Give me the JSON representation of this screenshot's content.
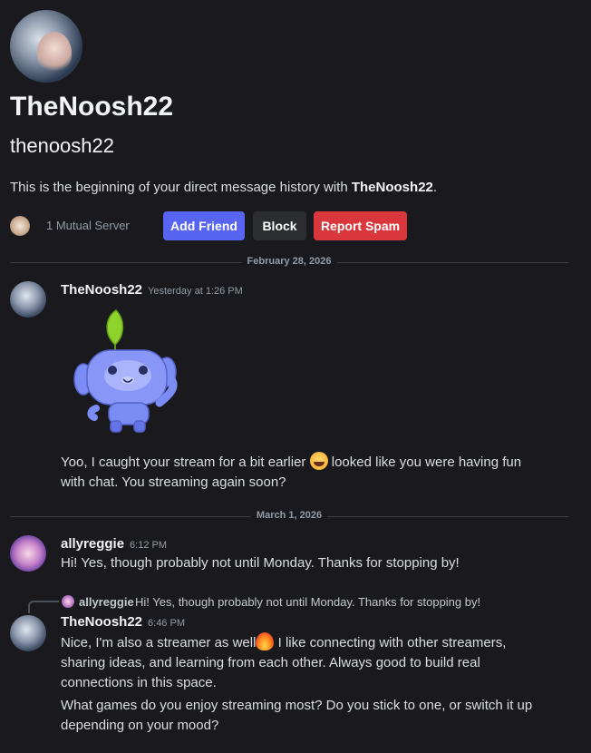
{
  "profile": {
    "display_name": "TheNoosh22",
    "username": "thenoosh22",
    "intro_prefix": "This is the beginning of your direct message history with ",
    "intro_name": "TheNoosh22",
    "intro_suffix": ".",
    "mutual_servers": "1 Mutual Server"
  },
  "actions": {
    "add_friend": "Add Friend",
    "block": "Block",
    "report_spam": "Report Spam"
  },
  "dividers": [
    "February 28, 2026",
    "March 1, 2026"
  ],
  "messages": [
    {
      "author": "TheNoosh22",
      "timestamp": "Yesterday at 1:26 PM",
      "text_before_emoji": "Yoo, I caught your stream for a bit earlier ",
      "text_after_emoji": " looked like you were having fun",
      "text_line2": "with chat. You streaming again soon?",
      "emoji": "joy-emoji"
    },
    {
      "author": "allyreggie",
      "timestamp": "6:12 PM",
      "text": "Hi! Yes, though probably not until Monday. Thanks for stopping by!"
    },
    {
      "reply_author": "allyreggie",
      "reply_text": "Hi! Yes, though probably not until Monday. Thanks for stopping by!",
      "author": "TheNoosh22",
      "timestamp": "6:46 PM",
      "text_line1_before": "Nice, I'm also a streamer as well",
      "text_line1_after": " I like connecting with other streamers,",
      "text_line2": "sharing ideas, and learning from each other. Always good to build real",
      "text_line3": "connections in this space.",
      "text_line4": "What games do you enjoy streaming most? Do you stick to one, or switch it up",
      "text_line5": "depending on your mood?",
      "emoji": "fire-emoji"
    }
  ],
  "colors": {
    "background": "#1a1a1e",
    "blurple": "#5865f2",
    "danger": "#da373c",
    "secondary_button": "#2b2d31",
    "sticker_body": "#7b8cf5",
    "sticker_leaf": "#8ed32b"
  }
}
